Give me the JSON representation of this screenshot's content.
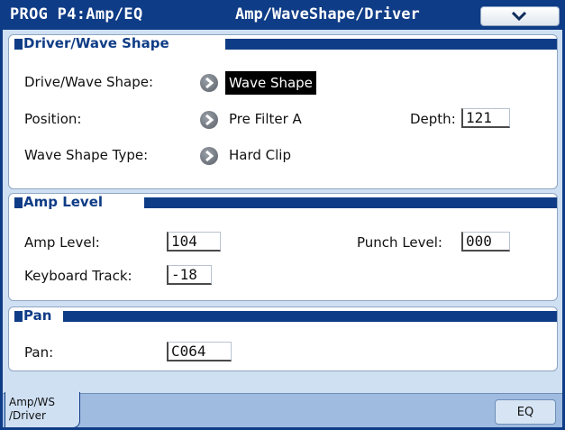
{
  "title": {
    "left": "PROG P4:Amp/EQ",
    "right": "Amp/WaveShape/Driver"
  },
  "menu_icon": "chevron-down-icon",
  "driver": {
    "header": "Driver/Wave Shape",
    "drive_label": "Drive/Wave Shape:",
    "drive_value": "Wave Shape",
    "position_label": "Position:",
    "position_value": "Pre Filter A",
    "depth_label": "Depth:",
    "depth_value": "121",
    "type_label": "Wave Shape Type:",
    "type_value": "Hard Clip"
  },
  "amp": {
    "header": "Amp Level",
    "level_label": "Amp Level:",
    "level_value": "104",
    "punch_label": "Punch Level:",
    "punch_value": "000",
    "track_label": "Keyboard Track:",
    "track_value": "-18"
  },
  "pan": {
    "header": "Pan",
    "label": "Pan:",
    "value": "C064"
  },
  "tabs": {
    "active_line1": "Amp/WS",
    "active_line2": "/Driver",
    "eq": "EQ"
  },
  "colors": {
    "accent": "#0f3c86",
    "panel_bg": "#ffffff",
    "screen_bg": "#cfe0f3",
    "tab_strip": "#9fbce0"
  }
}
